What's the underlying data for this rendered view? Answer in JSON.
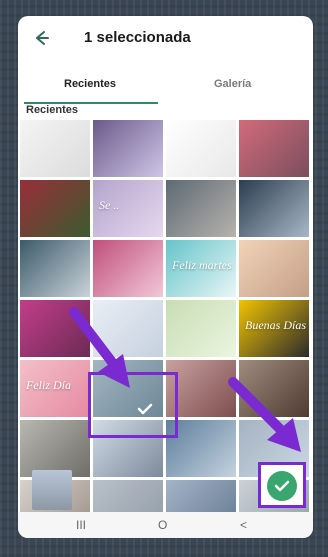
{
  "header": {
    "title": "1 seleccionada"
  },
  "tabs": [
    {
      "label": "Recientes",
      "active": true
    },
    {
      "label": "Galería",
      "active": false
    }
  ],
  "section": {
    "label": "Recientes"
  },
  "grid_tiles": [
    {
      "label": "",
      "colors": [
        "#f4f4f4",
        "#dcdcdc"
      ]
    },
    {
      "label": "",
      "colors": [
        "#6b5a8a",
        "#cfc6e7"
      ]
    },
    {
      "label": "",
      "colors": [
        "#ffffff",
        "#e8e8e8"
      ]
    },
    {
      "label": "",
      "colors": [
        "#d26b7b",
        "#7a4e5d"
      ]
    },
    {
      "label": "",
      "colors": [
        "#9a2d3a",
        "#3a5c2e"
      ]
    },
    {
      "label": "Se ..",
      "colors": [
        "#b4a4cc",
        "#e6d8ef"
      ]
    },
    {
      "label": "",
      "colors": [
        "#5d6a74",
        "#b7b2ad"
      ]
    },
    {
      "label": "",
      "colors": [
        "#2c3d50",
        "#a8b7c6"
      ]
    },
    {
      "label": "",
      "colors": [
        "#3c5a6a",
        "#c9d3d9"
      ]
    },
    {
      "label": "",
      "colors": [
        "#c04f7b",
        "#f2c8d8"
      ]
    },
    {
      "label": "Feliz martes",
      "colors": [
        "#66c4c9",
        "#e8f6f7"
      ]
    },
    {
      "label": "",
      "colors": [
        "#f1d3b8",
        "#c49f87"
      ]
    },
    {
      "label": "",
      "colors": [
        "#c33d8a",
        "#6b2b55"
      ]
    },
    {
      "label": "",
      "colors": [
        "#e9eef5",
        "#c6d1de"
      ]
    },
    {
      "label": "",
      "colors": [
        "#c8ddb4",
        "#eaf5df"
      ]
    },
    {
      "label": "Buenas Días",
      "colors": [
        "#f1c400",
        "#2b2b2b"
      ]
    },
    {
      "label": "Feliz Día",
      "colors": [
        "#f3c0c8",
        "#e68aa0"
      ]
    },
    {
      "label": "",
      "colors": [
        "#a3b6c2",
        "#6e8796"
      ]
    },
    {
      "label": "",
      "colors": [
        "#c8a0a0",
        "#7f4f4f"
      ]
    },
    {
      "label": "",
      "colors": [
        "#a08b7f",
        "#4e3b31"
      ]
    },
    {
      "label": "",
      "colors": [
        "#b8b7b2",
        "#6f6d67"
      ]
    },
    {
      "label": "",
      "colors": [
        "#d1dbe7",
        "#7d8a9a"
      ]
    },
    {
      "label": "",
      "colors": [
        "#5d7f9d",
        "#c4d2de"
      ]
    },
    {
      "label": "",
      "colors": [
        "#a4b3c2",
        "#cbd7e3"
      ]
    },
    {
      "label": "",
      "colors": [
        "#d6d2cd",
        "#9b8e85"
      ]
    },
    {
      "label": "",
      "colors": [
        "#b9c1c9",
        "#8f9aa6"
      ]
    },
    {
      "label": "",
      "colors": [
        "#a4b4c8",
        "#61778f"
      ]
    },
    {
      "label": "",
      "colors": [
        "#cbd1d6",
        "#8e9ba8"
      ]
    }
  ],
  "accent_colors": {
    "selection": "#7b2ad1",
    "tab": "#2a8a6a",
    "fab": "#3aa66f"
  },
  "icons": {
    "back": "arrow-left-icon",
    "check": "check-icon",
    "confirm": "check-circle-icon"
  },
  "nav": {
    "recent": "III",
    "home": "O",
    "back": "<"
  }
}
